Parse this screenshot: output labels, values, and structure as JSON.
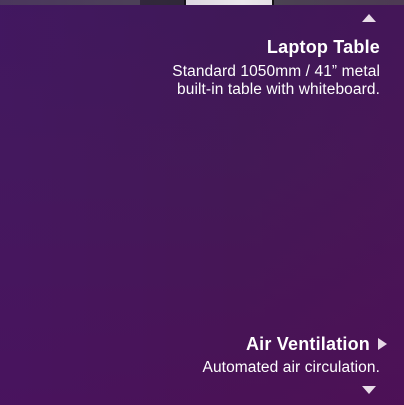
{
  "hotspots": {
    "laptop_table": {
      "title": "Laptop Table",
      "description_line1": "Standard 1050mm / 41” metal",
      "description_line2": "built-in table with whiteboard."
    },
    "air_ventilation": {
      "title": "Air Ventilation",
      "description": "Automated air circulation."
    }
  },
  "icons": {
    "up": "caret-up-icon",
    "down": "caret-down-icon",
    "right": "caret-right-icon"
  },
  "colors": {
    "background": "#431956",
    "text": "#ffffff"
  }
}
